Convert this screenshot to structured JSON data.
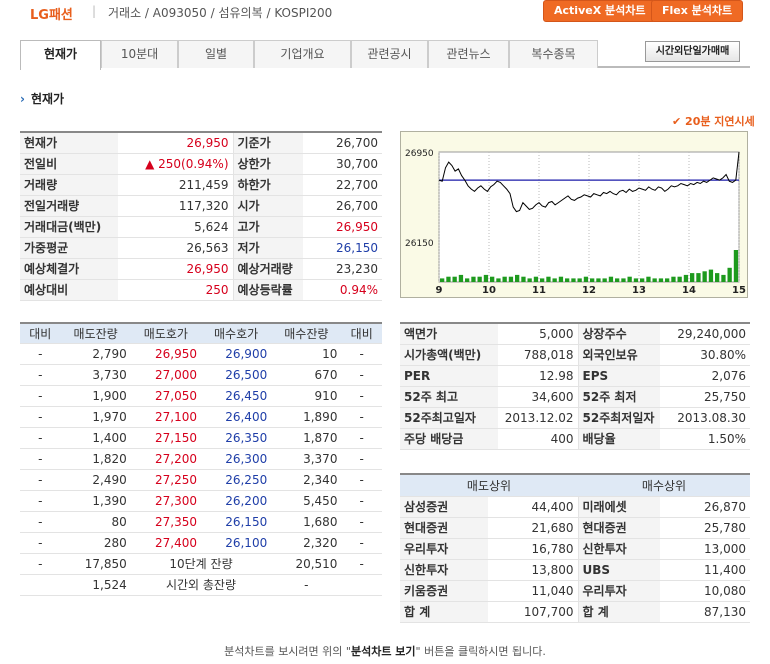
{
  "header": {
    "company": "LG패션",
    "breadcrumb": "거래소 / A093050 / 섬유의복 / KOSPI200",
    "activex_button": "ActiveX 분석차트",
    "flex_button": "Flex 분석차트"
  },
  "tabs": [
    "현재가",
    "10분대",
    "일별",
    "기업개요",
    "관련공시",
    "관련뉴스",
    "복수종목"
  ],
  "after_hours_button": "시간외단일가매매",
  "section_title": "현재가",
  "delay_notice": "✔ 20분 지연시세",
  "quote": [
    {
      "l1": "현재가",
      "v1": "26,950",
      "c1": "red",
      "l2": "기준가",
      "v2": "26,700",
      "c2": ""
    },
    {
      "l1": "전일비",
      "v1": "▲ 250(0.94%)",
      "c1": "red",
      "l2": "상한가",
      "v2": "30,700",
      "c2": ""
    },
    {
      "l1": "거래량",
      "v1": "211,459",
      "c1": "",
      "l2": "하한가",
      "v2": "22,700",
      "c2": ""
    },
    {
      "l1": "전일거래량",
      "v1": "117,320",
      "c1": "",
      "l2": "시가",
      "v2": "26,700",
      "c2": ""
    },
    {
      "l1": "거래대금(백만)",
      "v1": "5,624",
      "c1": "",
      "l2": "고가",
      "v2": "26,950",
      "c2": "red"
    },
    {
      "l1": "가중평균",
      "v1": "26,563",
      "c1": "",
      "l2": "저가",
      "v2": "26,150",
      "c2": "blue"
    },
    {
      "l1": "예상체결가",
      "v1": "26,950",
      "c1": "red",
      "l2": "예상거래량",
      "v2": "23,230",
      "c2": ""
    },
    {
      "l1": "예상대비",
      "v1": "250",
      "c1": "red",
      "l2": "예상등락률",
      "v2": "0.94%",
      "c2": "red"
    }
  ],
  "orderbook": {
    "headers": [
      "대비",
      "매도잔량",
      "매도호가",
      "매수호가",
      "매수잔량",
      "대비"
    ],
    "rows": [
      [
        "-",
        "2,790",
        "26,950",
        "26,900",
        "10",
        "-"
      ],
      [
        "-",
        "3,730",
        "27,000",
        "26,500",
        "670",
        "-"
      ],
      [
        "-",
        "1,900",
        "27,050",
        "26,450",
        "910",
        "-"
      ],
      [
        "-",
        "1,970",
        "27,100",
        "26,400",
        "1,890",
        "-"
      ],
      [
        "-",
        "1,400",
        "27,150",
        "26,350",
        "1,870",
        "-"
      ],
      [
        "-",
        "1,820",
        "27,200",
        "26,300",
        "3,370",
        "-"
      ],
      [
        "-",
        "2,490",
        "27,250",
        "26,250",
        "2,340",
        "-"
      ],
      [
        "-",
        "1,390",
        "27,300",
        "26,200",
        "5,450",
        "-"
      ],
      [
        "-",
        "80",
        "27,350",
        "26,150",
        "1,680",
        "-"
      ],
      [
        "-",
        "280",
        "27,400",
        "26,100",
        "2,320",
        "-"
      ]
    ],
    "total_row": [
      "-",
      "17,850",
      "10단계 잔량",
      "20,510",
      "-"
    ],
    "after_row": [
      "1,524",
      "시간외 총잔량",
      "-"
    ]
  },
  "fundamentals": [
    [
      "액면가",
      "5,000",
      "상장주수",
      "29,240,000"
    ],
    [
      "시가총액(백만)",
      "788,018",
      "외국인보유",
      "30.80%"
    ],
    [
      "PER",
      "12.98",
      "EPS",
      "2,076"
    ],
    [
      "52주 최고",
      "34,600",
      "52주 최저",
      "25,750"
    ],
    [
      "52주최고일자",
      "2013.12.02",
      "52주최저일자",
      "2013.08.30"
    ],
    [
      "주당 배당금",
      "400",
      "배당율",
      "1.50%"
    ]
  ],
  "brokers": {
    "headers": [
      "매도상위",
      "매수상위"
    ],
    "rows": [
      [
        "삼성증권",
        "44,400",
        "미래에셋",
        "26,870"
      ],
      [
        "현대증권",
        "21,680",
        "현대증권",
        "25,780"
      ],
      [
        "우리투자",
        "16,780",
        "신한투자",
        "13,000"
      ],
      [
        "신한투자",
        "13,800",
        "UBS",
        "11,400"
      ],
      [
        "키움증권",
        "11,040",
        "우리투자",
        "10,080"
      ],
      [
        "합 계",
        "107,700",
        "합 계",
        "87,130"
      ]
    ]
  },
  "footer": {
    "pre": "분석차트를 보시려면 위의 \"",
    "bold": "분석차트 보기",
    "post": "\" 버튼을 클릭하시면 됩니다."
  },
  "chart_data": {
    "type": "line",
    "y_tick_labels": [
      "26950",
      "26150"
    ],
    "x_tick_labels": [
      "9",
      "10",
      "11",
      "12",
      "13",
      "14",
      "15"
    ],
    "reference_price": 26700,
    "ylim": [
      26150,
      26950
    ],
    "price_line": [
      26700,
      26690,
      26810,
      26860,
      26830,
      26780,
      26800,
      26740,
      26700,
      26650,
      26620,
      26600,
      26630,
      26650,
      26620,
      26600,
      26640,
      26660,
      26690,
      26680,
      26650,
      26620,
      26580,
      26460,
      26420,
      26430,
      26500,
      26470,
      26440,
      26450,
      26480,
      26500,
      26470,
      26460,
      26500,
      26510,
      26480,
      26500,
      26520,
      26540,
      26560,
      26530,
      26520,
      26540,
      26550,
      26570,
      26560,
      26550,
      26580,
      26570,
      26560,
      26590,
      26580,
      26600,
      26580,
      26570,
      26600,
      26610,
      26590,
      26620,
      26600,
      26610,
      26630,
      26620,
      26610,
      26640,
      26620,
      26610,
      26640,
      26630,
      26600,
      26620,
      26650,
      26640,
      26650,
      26670,
      26660,
      26650,
      26670,
      26660,
      26680,
      26670,
      26690,
      26680,
      26700,
      26720,
      26710,
      26700,
      26720,
      26750,
      26690,
      26680,
      26700,
      26950
    ],
    "volume_bars": [
      2,
      3,
      3,
      4,
      2,
      3,
      3,
      4,
      3,
      2,
      3,
      3,
      4,
      3,
      2,
      3,
      2,
      3,
      2,
      3,
      2,
      2,
      2,
      3,
      2,
      2,
      2,
      3,
      2,
      2,
      3,
      2,
      2,
      3,
      2,
      2,
      2,
      3,
      3,
      4,
      5,
      5,
      6,
      7,
      5,
      4,
      8,
      18
    ],
    "colors": {
      "price": "#000000",
      "reference": "#1a1aa8",
      "volume": "#1e9a1e",
      "background": "#fafae6"
    }
  }
}
